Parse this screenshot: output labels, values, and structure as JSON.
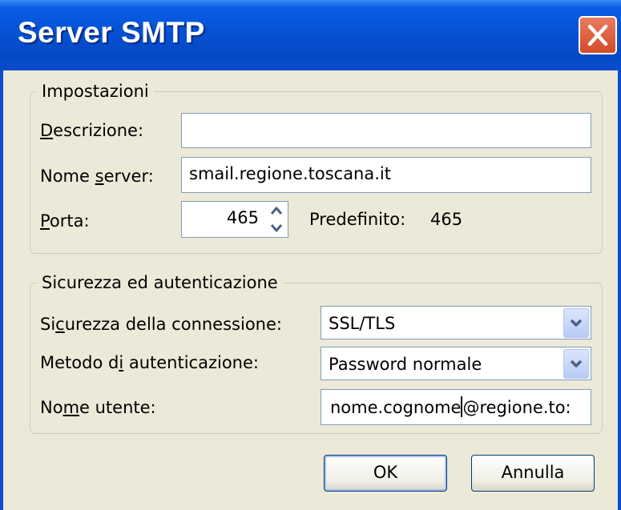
{
  "window": {
    "title": "Server SMTP"
  },
  "settings": {
    "legend": "Impostazioni",
    "description": {
      "label_prefix": "",
      "label_mnemonic": "D",
      "label_suffix": "escrizione:",
      "value": ""
    },
    "server_name": {
      "label_prefix": "Nome ",
      "label_mnemonic": "s",
      "label_suffix": "erver:",
      "value": "smail.regione.toscana.it"
    },
    "port": {
      "label_prefix": "",
      "label_mnemonic": "P",
      "label_suffix": "orta:",
      "value": "465",
      "default_label": "Predefinito:",
      "default_value": "465"
    }
  },
  "security": {
    "legend": "Sicurezza ed autenticazione",
    "connection_security": {
      "label_prefix": "Si",
      "label_mnemonic": "c",
      "label_suffix": "urezza della connessione:",
      "value": "SSL/TLS"
    },
    "auth_method": {
      "label_prefix": "Metodo d",
      "label_mnemonic": "i",
      "label_suffix": " autenticazione:",
      "value": "Password normale"
    },
    "username": {
      "label_prefix": "No",
      "label_mnemonic": "m",
      "label_suffix": "e utente:",
      "value_before_cursor": "nome.cognome",
      "value_after_cursor": "@regione.to:"
    }
  },
  "buttons": {
    "ok": "OK",
    "cancel": "Annulla"
  },
  "colors": {
    "titlebar": "#0651d4",
    "close_button": "#d34a28",
    "dialog_bg": "#ece9d8",
    "field_border": "#7f9db9"
  },
  "icons": {
    "close": "close-x-icon",
    "spin_up": "arrow-up-icon",
    "spin_down": "arrow-down-icon",
    "dropdown": "chevron-down-icon"
  }
}
